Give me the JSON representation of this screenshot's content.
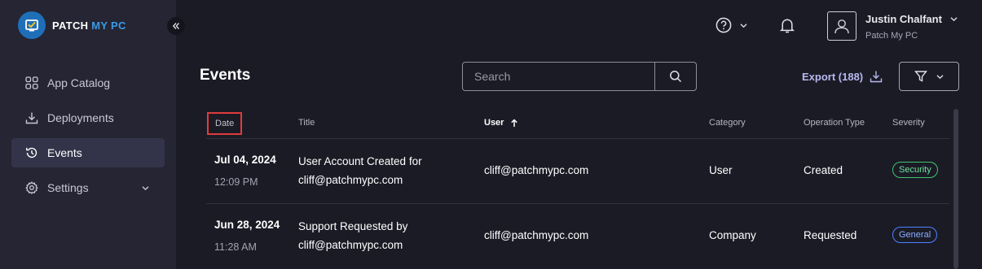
{
  "brand": {
    "name_part1": "PATCH ",
    "name_part2": "MY PC"
  },
  "sidebar": {
    "items": [
      {
        "label": "App Catalog",
        "icon": "app-catalog-icon"
      },
      {
        "label": "Deployments",
        "icon": "download-icon"
      },
      {
        "label": "Events",
        "icon": "history-icon",
        "active": true
      },
      {
        "label": "Settings",
        "icon": "gear-icon"
      }
    ]
  },
  "user": {
    "name": "Justin Chalfant",
    "org": "Patch My PC"
  },
  "page": {
    "title": "Events",
    "search_placeholder": "Search",
    "export_label": "Export (188)"
  },
  "table": {
    "columns": [
      "Date",
      "Title",
      "User",
      "Category",
      "Operation Type",
      "Severity"
    ],
    "rows": [
      {
        "date": "Jul 04, 2024",
        "time": "12:09 PM",
        "title_line1": "User Account Created for",
        "title_line2": "cliff@patchmypc.com",
        "user": "cliff@patchmypc.com",
        "category": "User",
        "operation": "Created",
        "severity": "Security"
      },
      {
        "date": "Jun 28, 2024",
        "time": "11:28 AM",
        "title_line1": "Support Requested by",
        "title_line2": "cliff@patchmypc.com",
        "user": "cliff@patchmypc.com",
        "category": "Company",
        "operation": "Requested",
        "severity": "General"
      }
    ]
  },
  "colors": {
    "background": "#1b1b26",
    "sidebar": "#252533",
    "accent": "#b8b8f0",
    "security": "#3fc46e",
    "general": "#4d82ff",
    "highlight": "#e03c3c"
  }
}
